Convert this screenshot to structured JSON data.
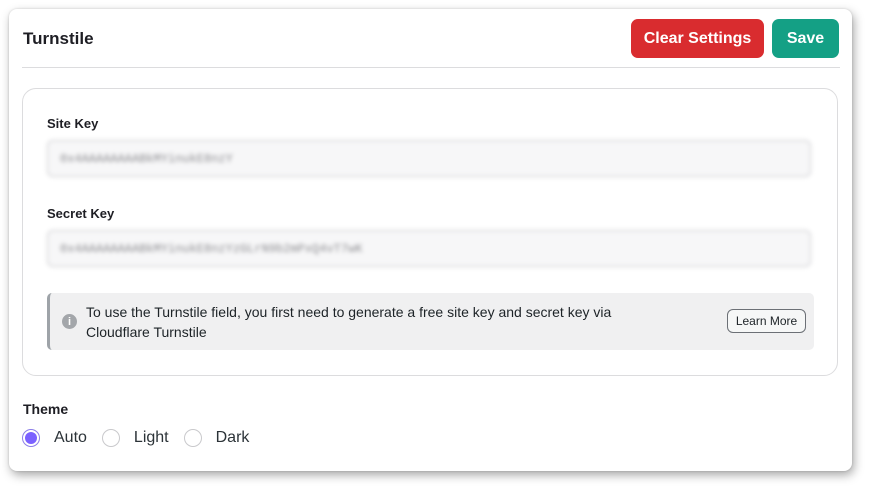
{
  "header": {
    "title": "Turnstile",
    "clear_label": "Clear Settings",
    "save_label": "Save"
  },
  "colors": {
    "clear_button": "#d92c2f",
    "save_button": "#14a085",
    "radio_accent": "#7b61ff"
  },
  "fields": {
    "site_key": {
      "label": "Site Key",
      "value": "0x4AAAAAAAABkMYinukE8nzY"
    },
    "secret_key": {
      "label": "Secret Key",
      "value": "0x4AAAAAAAABkMYinukE8nzYzGLrN9b2mPxQ4vT7wK"
    }
  },
  "notice": {
    "icon": "info-icon",
    "text": "To use the Turnstile field, you first need to generate a free site key and secret key via Cloudflare Turnstile",
    "button_label": "Learn More"
  },
  "theme": {
    "label": "Theme",
    "options": [
      {
        "label": "Auto",
        "checked": true
      },
      {
        "label": "Light",
        "checked": false
      },
      {
        "label": "Dark",
        "checked": false
      }
    ]
  }
}
